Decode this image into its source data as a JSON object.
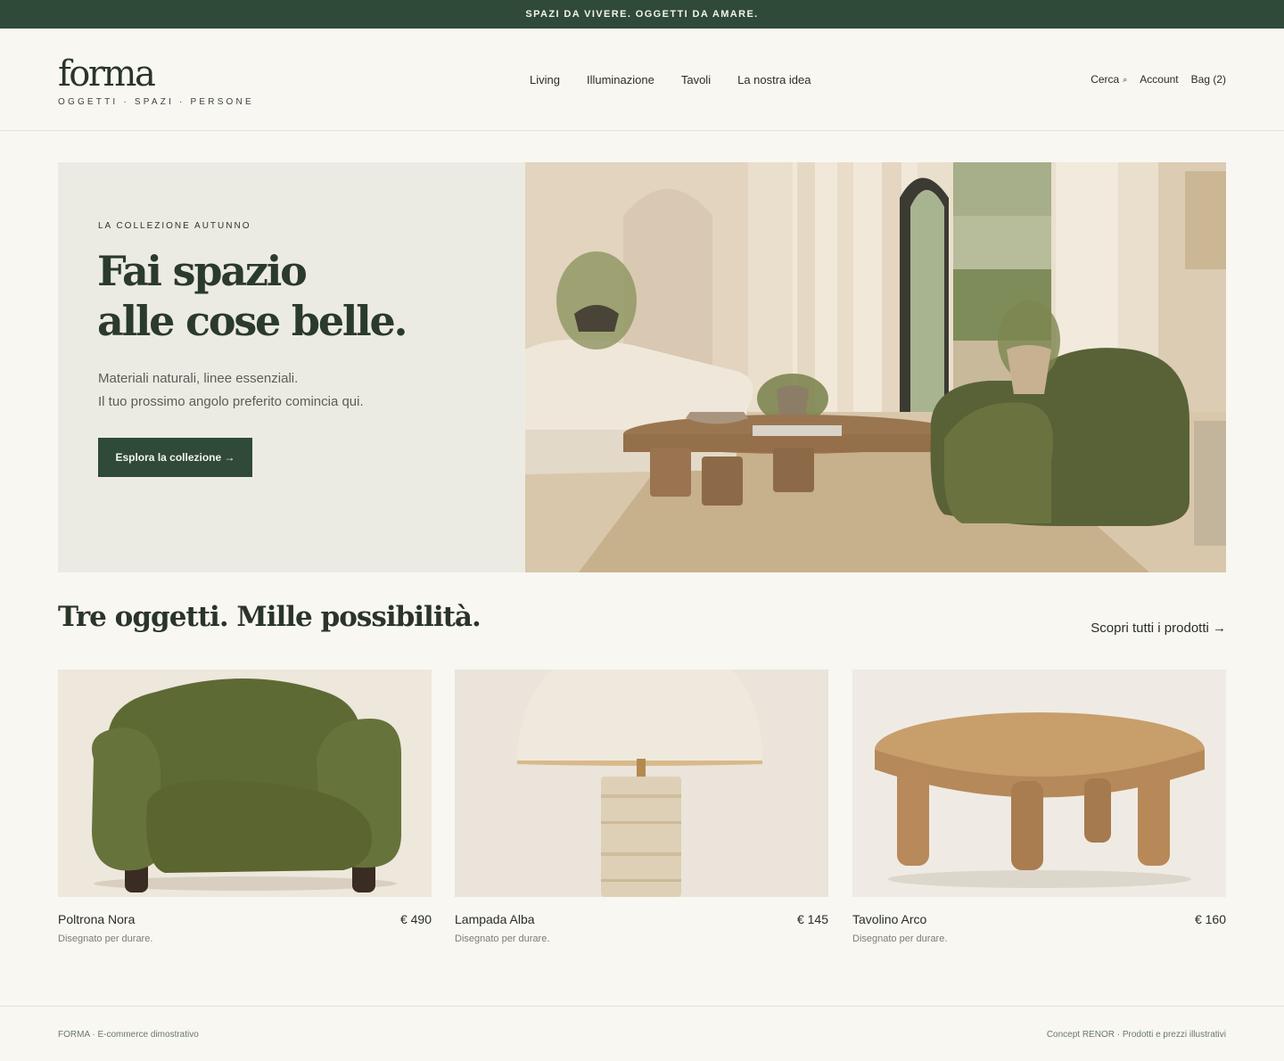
{
  "announcement": "SPAZI DA VIVERE. OGGETTI DA AMARE.",
  "brand": {
    "logo": "forma",
    "tagline": "OGGETTI · SPAZI · PERSONE"
  },
  "nav": [
    "Living",
    "Illuminazione",
    "Tavoli",
    "La nostra idea"
  ],
  "utility": {
    "search": "Cerca",
    "account": "Account",
    "bag": "Bag (2)"
  },
  "hero": {
    "eyebrow": "LA COLLEZIONE AUTUNNO",
    "title_line1": "Fai spazio",
    "title_line2": "alle cose belle.",
    "subtitle_line1": "Materiali naturali, linee essenziali.",
    "subtitle_line2": "Il tuo prossimo angolo preferito comincia qui.",
    "cta": "Esplora la collezione →"
  },
  "products_section": {
    "title": "Tre oggetti. Mille possibilità.",
    "see_all": "Scopri tutti i prodotti →"
  },
  "products": [
    {
      "name": "Poltrona Nora",
      "price": "€ 490",
      "desc": "Disegnato per durare.",
      "icon": "armchair"
    },
    {
      "name": "Lampada Alba",
      "price": "€ 145",
      "desc": "Disegnato per durare.",
      "icon": "table-lamp"
    },
    {
      "name": "Tavolino Arco",
      "price": "€ 160",
      "desc": "Disegnato per durare.",
      "icon": "coffee-table"
    }
  ],
  "footer": {
    "left": "FORMA · E-commerce dimostrativo",
    "right": "Concept RENOR · Prodotti e prezzi illustrativi"
  },
  "colors": {
    "brand_green": "#2f4a39",
    "background": "#f8f7f2",
    "hero_panel": "#ecebe3",
    "olive": "#55602f"
  }
}
